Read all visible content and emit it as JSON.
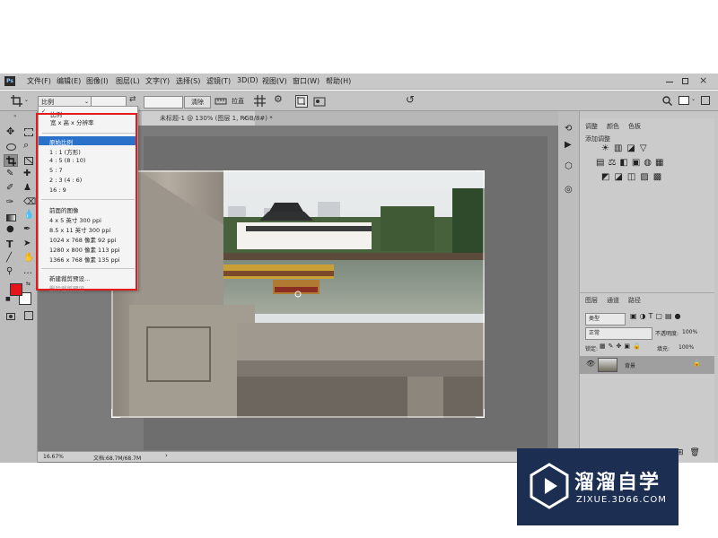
{
  "menu": [
    "文件(F)",
    "编辑(E)",
    "图像(I)",
    "图层(L)",
    "文字(Y)",
    "选择(S)",
    "滤镜(T)",
    "3D(D)",
    "视图(V)",
    "窗口(W)",
    "帮助(H)"
  ],
  "options": {
    "ratio_select": "比例",
    "clear_button": "清除",
    "straighten_label": "拉直"
  },
  "doc_tab": "未标题-1 @ 130% (图层 1, RGB/8#) *",
  "dropdown": {
    "items": [
      "比例",
      "宽 x 高 x 分辨率",
      "原始比例",
      "1 : 1 (方形)",
      "4 : 5 (8 : 10)",
      "5 : 7",
      "2 : 3 (4 : 6)",
      "16 : 9",
      "前面的图像",
      "4 x 5 英寸 300 ppi",
      "8.5 x 11 英寸 300 ppi",
      "1024 x 768 像素 92 ppi",
      "1280 x 800 像素 113 ppi",
      "1366 x 768 像素 135 ppi",
      "新建裁剪预设...",
      "删除裁剪预设..."
    ]
  },
  "status": {
    "zoom": "16.67%",
    "doc": "文档:68.7M/68.7M"
  },
  "adjust_panel": {
    "tabs": [
      "调整",
      "颜色",
      "色板"
    ],
    "subtitle": "添加调整"
  },
  "layers_panel": {
    "tabs": [
      "图层",
      "通道",
      "路径"
    ],
    "kind": "类型",
    "blend": "正常",
    "opacity_label": "不透明度:",
    "opacity": "100%",
    "lock_label": "锁定:",
    "fill_label": "填充:",
    "fill": "100%",
    "layer_name": "背景"
  },
  "watermark": {
    "title": "溜溜自学",
    "url": "ZIXUE.3D66.COM"
  },
  "colors": {
    "foreground": "#e5161b",
    "background": "#ffffff",
    "highlight": "#2a72c9",
    "annotation": "#e41b1b",
    "watermark_bg": "#1c2f52"
  }
}
